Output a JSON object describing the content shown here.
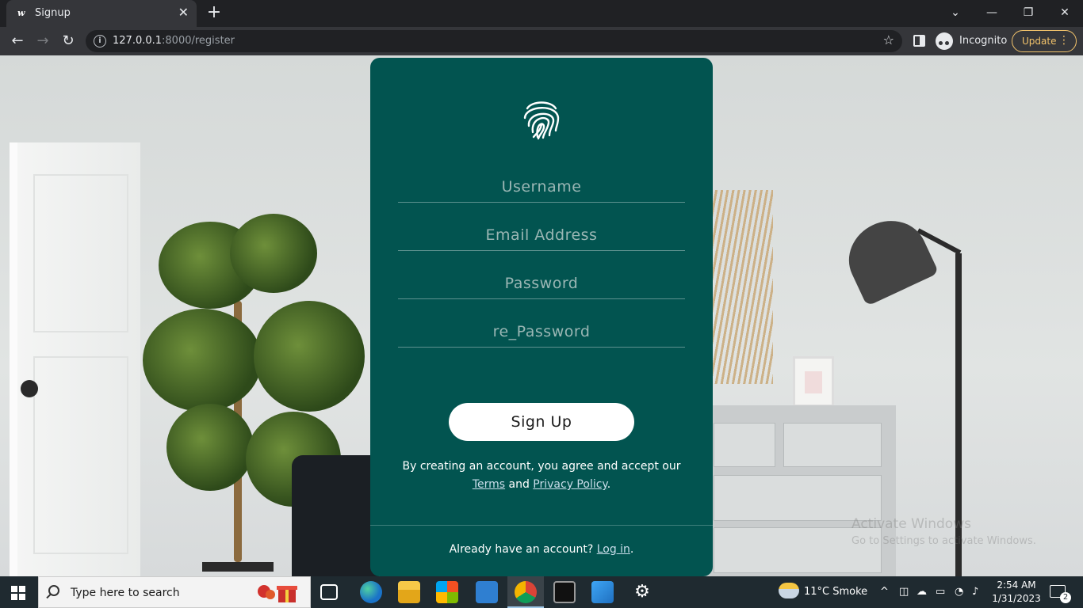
{
  "browser": {
    "tab_title": "Signup",
    "favicon_letter": "w",
    "new_tab": "+",
    "url_host": "127.0.0.1",
    "url_rest": ":8000/register",
    "profile_label": "Incognito",
    "update_label": "Update"
  },
  "form": {
    "username_placeholder": "Username",
    "email_placeholder": "Email Address",
    "password_placeholder": "Password",
    "repassword_placeholder": "re_Password",
    "submit_label": "Sign Up",
    "legal_text": "By creating an account, you agree and accept our",
    "terms_link": "Terms",
    "and_text": "and",
    "privacy_link": "Privacy Policy",
    "period": ".",
    "login_prompt": "Already have an account?",
    "login_link": "Log in"
  },
  "watermark": {
    "title": "Activate Windows",
    "subtitle": "Go to Settings to activate Windows."
  },
  "taskbar": {
    "search_placeholder": "Type here to search",
    "weather": "11°C  Smoke",
    "time": "2:54 AM",
    "date": "1/31/2023",
    "notifications": "2"
  },
  "colors": {
    "card": "#025450",
    "chrome_dark": "#202124",
    "chrome_toolbar": "#35363a",
    "update_accent": "#f2c36b"
  }
}
